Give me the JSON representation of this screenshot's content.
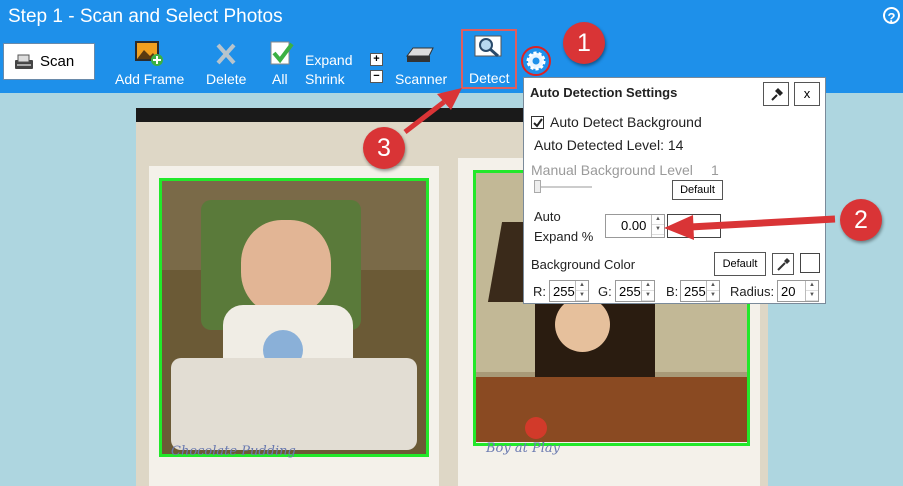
{
  "header": {
    "title": "Step 1 - Scan and Select Photos",
    "help_icon": "question-mark-icon",
    "help_text": "?"
  },
  "toolbar": {
    "scan_label": "Scan",
    "add_frame_label": "Add Frame",
    "delete_label": "Delete",
    "all_label": "All",
    "expand_label": "Expand",
    "shrink_label": "Shrink",
    "expand_symbol": "+",
    "shrink_symbol": "−",
    "scanner_label": "Scanner",
    "detect_label": "Detect"
  },
  "annotations": {
    "badge1": "1",
    "badge2": "2",
    "badge3": "3"
  },
  "panel": {
    "title": "Auto Detection Settings",
    "close_label": "x",
    "auto_detect_background_label": "Auto Detect Background",
    "auto_detect_background_checked": true,
    "auto_detected_level_label": "Auto Detected Level: 14",
    "manual_background_level_label": "Manual Background Level",
    "manual_background_level_value": "1",
    "default_label": "Default",
    "auto_expand_label_line1": "Auto",
    "auto_expand_label_line2": "Expand %",
    "auto_expand_value": "0.00",
    "background_color_label": "Background Color",
    "background_default_label": "Default",
    "r_label": "R:",
    "r_value": "255",
    "g_label": "G:",
    "g_value": "255",
    "b_label": "B:",
    "b_value": "255",
    "radius_label": "Radius:",
    "radius_value": "20",
    "selected_color": "#ffffff"
  },
  "photos": {
    "caption_left": "Chocolate Pudding",
    "caption_right": "Boy at Play"
  },
  "colors": {
    "toolbar_bg": "#1e90ea",
    "selection_green": "#22e82a",
    "highlight_red": "#d93436"
  }
}
